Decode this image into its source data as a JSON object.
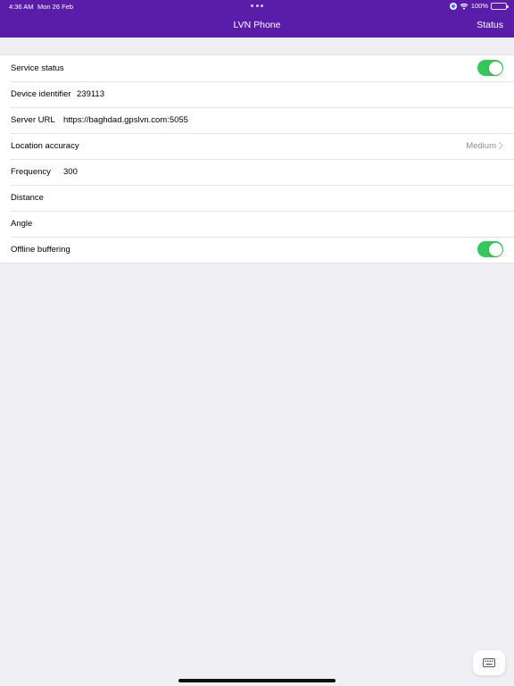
{
  "status_bar": {
    "time": "4:36 AM",
    "date": "Mon 26 Feb",
    "battery": "100%",
    "icons": [
      "location-icon",
      "wifi-icon",
      "battery-icon"
    ]
  },
  "nav": {
    "title": "LVN Phone",
    "action": "Status",
    "background": "#5a1da9"
  },
  "settings": {
    "service_status": {
      "label": "Service status",
      "enabled": true
    },
    "device_identifier": {
      "label": "Device identifier",
      "value": "239113"
    },
    "server_url": {
      "label": "Server URL",
      "value": "https://baghdad.gpslvn.com:5055"
    },
    "location_accuracy": {
      "label": "Location accuracy",
      "value": "Medium"
    },
    "frequency": {
      "label": "Frequency",
      "value": "300"
    },
    "distance": {
      "label": "Distance",
      "value": ""
    },
    "angle": {
      "label": "Angle",
      "value": ""
    },
    "offline_buffering": {
      "label": "Offline buffering",
      "enabled": true
    }
  },
  "colors": {
    "toggle_on": "#34c759",
    "background": "#f0eff4"
  },
  "keyboard_button": {
    "icon": "keyboard-icon"
  }
}
